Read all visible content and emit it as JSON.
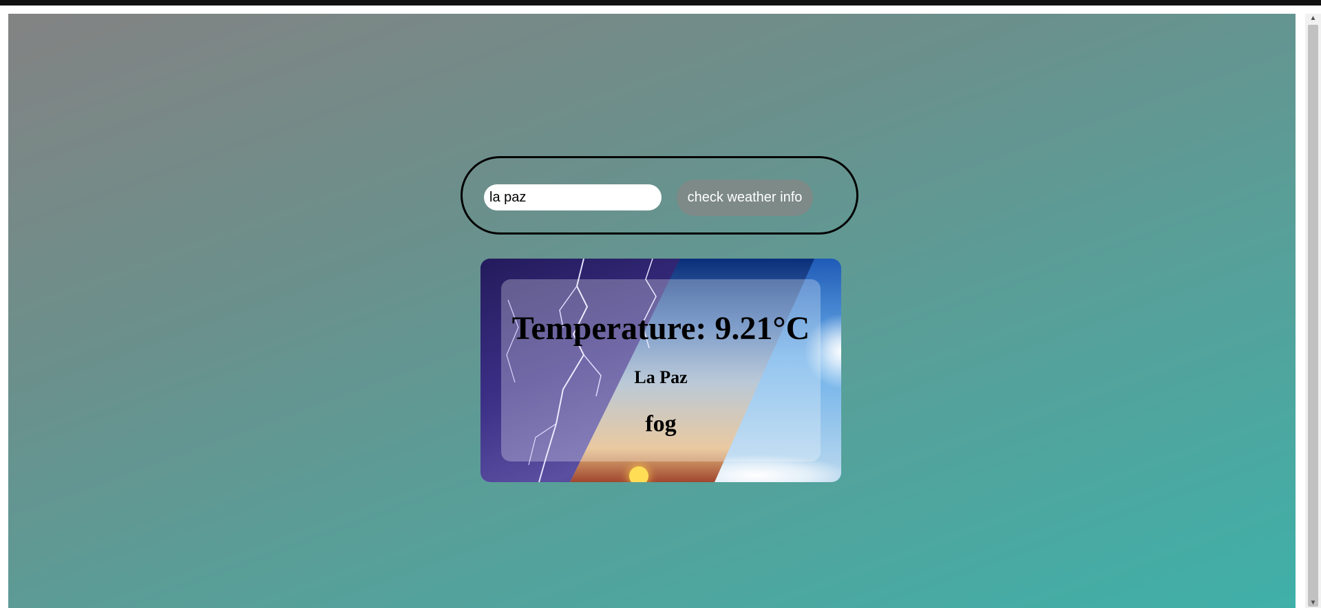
{
  "search": {
    "value": "la paz",
    "button_label": "check weather info"
  },
  "weather": {
    "temperature_text": "Temperature: 9.21°C",
    "city": "La Paz",
    "condition": "fog"
  },
  "colors": {
    "background_start": "#838383",
    "background_end": "#3fb0a8",
    "button_bg": "#7d8a87"
  }
}
